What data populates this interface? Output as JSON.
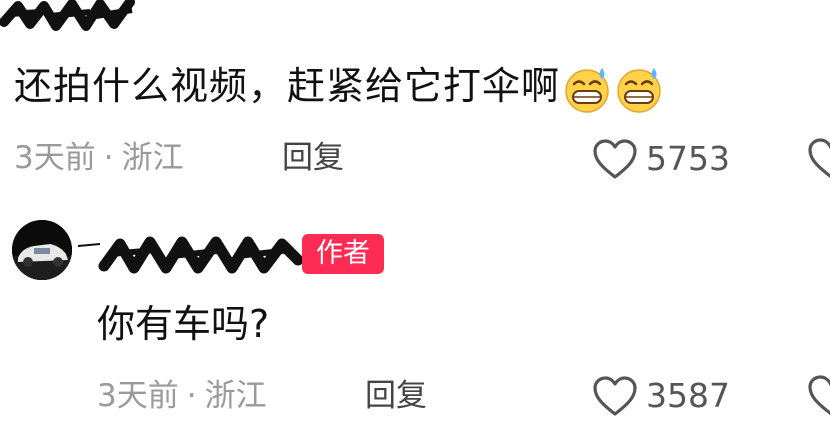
{
  "comments": [
    {
      "text": "还拍什么视频，赶紧给它打伞啊",
      "emojis": [
        "grin-sweat-emoji",
        "grin-sweat-emoji"
      ],
      "time": "3天前",
      "separator": "·",
      "location": "浙江",
      "reply_label": "回复",
      "likes": "5753"
    },
    {
      "badge": "作者",
      "text": "你有车吗?",
      "time": "3天前",
      "separator": "·",
      "location": "浙江",
      "reply_label": "回复",
      "likes": "3587"
    }
  ],
  "colors": {
    "badge": "#fe2c55",
    "meta": "#9a9a9a",
    "text": "#111111"
  }
}
